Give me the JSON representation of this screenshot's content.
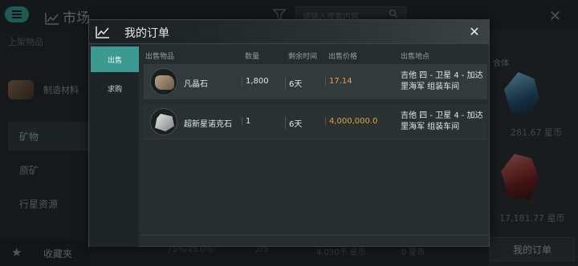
{
  "background": {
    "title": "市场",
    "search_placeholder": "请输入搜索内容",
    "sidebar_header": "上架物品",
    "sidebar_items": [
      "制造材料",
      "矿物",
      "原矿",
      "行星资源"
    ],
    "favorites_label": "收藏夹",
    "right_label": "合体",
    "prices": [
      "281.67 星币",
      "17,181.77 星币"
    ],
    "bottom_stats": [
      "75%/15.0%",
      "2/5",
      "4,030千 星币",
      "0 星币"
    ],
    "my_orders_button": "我的订单"
  },
  "modal": {
    "title": "我的订单",
    "tabs": [
      {
        "label": "出售",
        "active": true
      },
      {
        "label": "求购",
        "active": false
      }
    ],
    "columns": [
      "出售物品",
      "数量",
      "剩余时间",
      "出售价格",
      "出售地点"
    ],
    "orders": [
      {
        "item": "凡晶石",
        "icon": "veldspar-ore-icon",
        "quantity": "1,800",
        "time_left": "6天",
        "price": "17.14",
        "location": "吉他 四 - 卫星 4 - 加达里海军 组装车间"
      },
      {
        "item": "超新星诺克石",
        "icon": "nocxite-ore-icon",
        "quantity": "1",
        "time_left": "6天",
        "price": "4,000,000.0",
        "location": "吉他 四 - 卫星 4 - 加达里海军 组装车间"
      }
    ]
  },
  "colors": {
    "accent": "#3d9a90",
    "price": "#e3a23e",
    "panel": "#262d2e"
  }
}
